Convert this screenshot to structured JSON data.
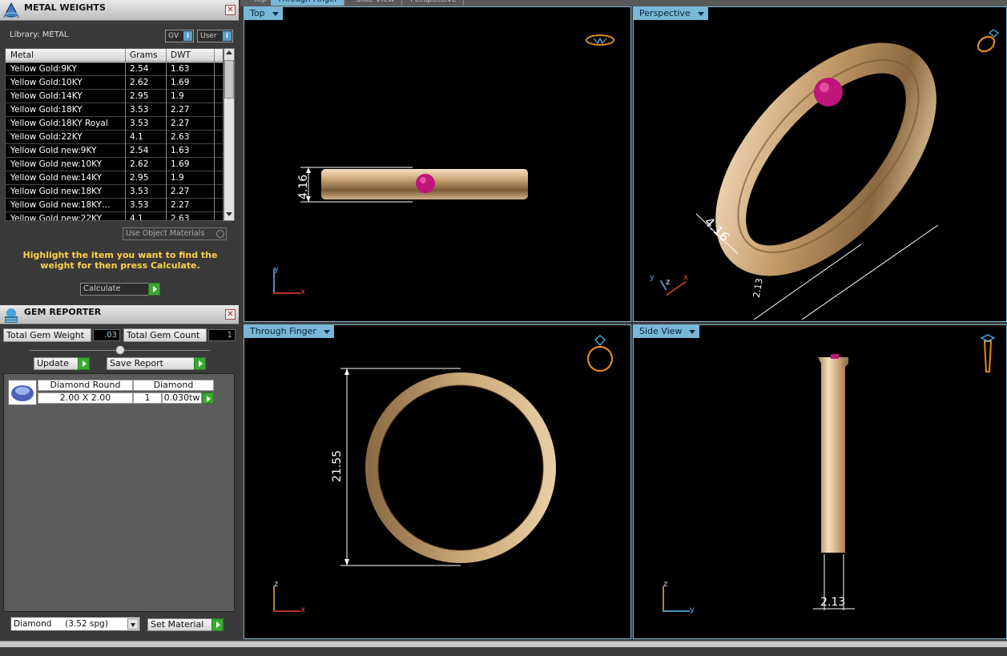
{
  "top_tabs": [
    "Top",
    "Through Finger",
    "Side View",
    "Perspective"
  ],
  "metal_weights": {
    "title": "METAL WEIGHTS",
    "library_label": "Library: METAL",
    "gv_label": "GV",
    "user_label": "User",
    "columns": [
      "Metal",
      "Grams",
      "DWT"
    ],
    "rows": [
      [
        "Yellow Gold:9KY",
        "2.54",
        "1.63"
      ],
      [
        "Yellow Gold:10KY",
        "2.62",
        "1.69"
      ],
      [
        "Yellow Gold:14KY",
        "2.95",
        "1.9"
      ],
      [
        "Yellow Gold:18KY",
        "3.53",
        "2.27"
      ],
      [
        "Yellow Gold:18KY Royal",
        "3.53",
        "2.27"
      ],
      [
        "Yellow Gold:22KY",
        "4.1",
        "2.63"
      ],
      [
        "Yellow Gold new:9KY",
        "2.54",
        "1.63"
      ],
      [
        "Yellow Gold new:10KY",
        "2.62",
        "1.69"
      ],
      [
        "Yellow Gold new:14KY",
        "2.95",
        "1.9"
      ],
      [
        "Yellow Gold new:18KY",
        "3.53",
        "2.27"
      ],
      [
        "Yellow Gold new:18KY…",
        "3.53",
        "2.27"
      ],
      [
        "Yellow Gold new:22KY",
        "4.1",
        "2.63"
      ]
    ],
    "use_object_materials": "Use Object Materials",
    "hint": "Highlight the item you want to find the weight for then press Calculate.",
    "calculate": "Calculate"
  },
  "gem_reporter": {
    "title": "GEM REPORTER",
    "total_weight_label": "Total Gem Weight",
    "total_weight_value": ".03",
    "total_count_label": "Total Gem Count",
    "total_count_value": "1",
    "update": "Update",
    "save_report": "Save Report",
    "gem": {
      "shape": "Diamond Round",
      "size": "2.00 X 2.00",
      "material": "Diamond",
      "count": "1",
      "weight": "0.030tw"
    },
    "material_select": "Diamond     (3.52 spg)",
    "set_material": "Set Material"
  },
  "viewports": {
    "top": {
      "label": "Top",
      "dim": "4.16",
      "axis1": "y",
      "axis2": "x"
    },
    "perspective": {
      "label": "Perspective",
      "dim": "4.16",
      "dim2": "2.13",
      "axis1": "y",
      "axis2": "z",
      "axis3": "x"
    },
    "through_finger": {
      "label": "Through Finger",
      "dim": "21.55",
      "axis1": "z",
      "axis2": "x"
    },
    "side": {
      "label": "Side View",
      "dim": "2.13",
      "axis1": "z",
      "axis2": "y"
    }
  },
  "colors": {
    "accent": "#79b7d8",
    "gold": "#d6b382",
    "gem": "#c0157a",
    "hint": "#ffd24a",
    "go": "#3aa832"
  }
}
